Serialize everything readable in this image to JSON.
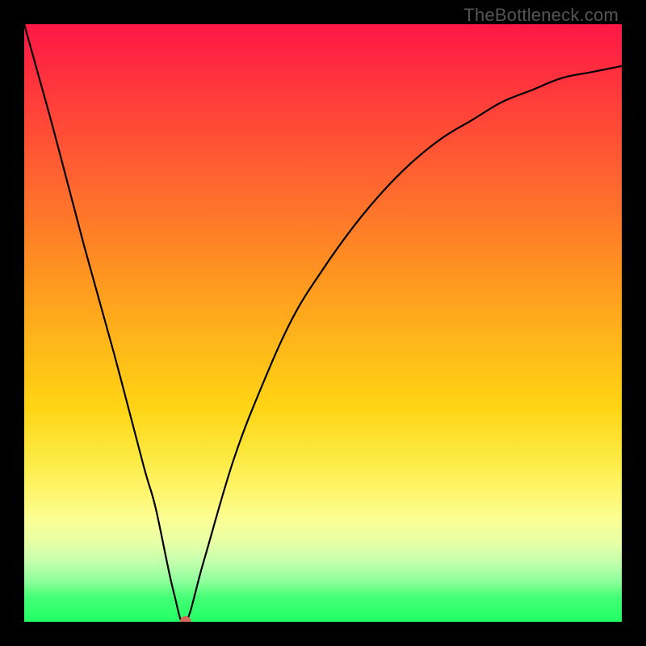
{
  "watermark": {
    "text": "TheBottleneck.com"
  },
  "chart_data": {
    "type": "line",
    "title": "",
    "xlabel": "",
    "ylabel": "",
    "xlim": [
      0,
      100
    ],
    "ylim": [
      0,
      100
    ],
    "background": "rainbow-vertical-red-to-green",
    "series": [
      {
        "name": "bottleneck-curve",
        "x": [
          0,
          5,
          10,
          15,
          20,
          22,
          25,
          27,
          30,
          35,
          40,
          45,
          50,
          55,
          60,
          65,
          70,
          75,
          80,
          85,
          90,
          95,
          100
        ],
        "y": [
          100,
          82,
          63,
          45,
          26,
          19,
          5,
          0,
          10,
          27,
          40,
          51,
          59,
          66,
          72,
          77,
          81,
          84,
          87,
          89,
          91,
          92,
          93
        ]
      }
    ],
    "marker": {
      "x": 27,
      "y": 0,
      "color": "#d16a5b",
      "radius": 7
    },
    "notes": "Values are percentages of plot width/height, estimated from gradient and curve position."
  }
}
